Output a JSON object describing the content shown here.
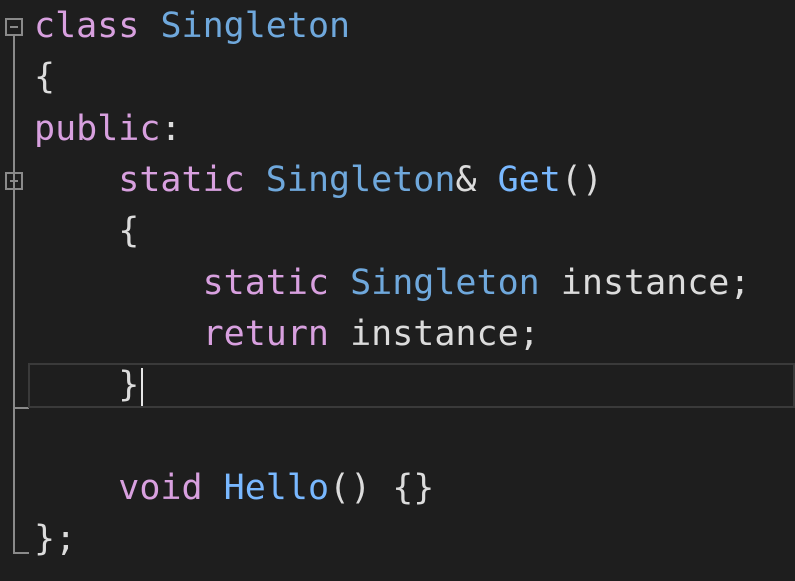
{
  "code_lines": [
    {
      "tokens": [
        {
          "text": "class ",
          "kind": "keyword"
        },
        {
          "text": "Singleton",
          "kind": "type"
        }
      ]
    },
    {
      "tokens": [
        {
          "text": "{",
          "kind": "plain"
        }
      ]
    },
    {
      "tokens": [
        {
          "text": "public",
          "kind": "keyword"
        },
        {
          "text": ":",
          "kind": "plain"
        }
      ]
    },
    {
      "tokens": [
        {
          "text": "    static ",
          "kind": "keyword"
        },
        {
          "text": "Singleton",
          "kind": "type"
        },
        {
          "text": "& ",
          "kind": "plain"
        },
        {
          "text": "Get",
          "kind": "function"
        },
        {
          "text": "()",
          "kind": "plain"
        }
      ]
    },
    {
      "tokens": [
        {
          "text": "    {",
          "kind": "plain"
        }
      ]
    },
    {
      "tokens": [
        {
          "text": "        static ",
          "kind": "keyword"
        },
        {
          "text": "Singleton",
          "kind": "type"
        },
        {
          "text": " instance;",
          "kind": "plain"
        }
      ]
    },
    {
      "tokens": [
        {
          "text": "        return ",
          "kind": "keyword"
        },
        {
          "text": "instance;",
          "kind": "plain"
        }
      ]
    },
    {
      "tokens": [
        {
          "text": "    }",
          "kind": "plain"
        }
      ]
    },
    {
      "tokens": []
    },
    {
      "tokens": [
        {
          "text": "    void ",
          "kind": "keyword"
        },
        {
          "text": "Hello",
          "kind": "function"
        },
        {
          "text": "() {}",
          "kind": "plain"
        }
      ]
    },
    {
      "tokens": [
        {
          "text": "};",
          "kind": "plain"
        }
      ]
    }
  ],
  "colors": {
    "background": "#1e1e1e",
    "keyword": "#d8a0df",
    "type": "#6fa8dc",
    "function": "#79b8ff",
    "plain": "#dcdcdc",
    "fold_guide": "#8a8a8a"
  },
  "icons": {
    "fold_class": "collapse-minus-icon",
    "fold_function": "collapse-minus-icon"
  }
}
